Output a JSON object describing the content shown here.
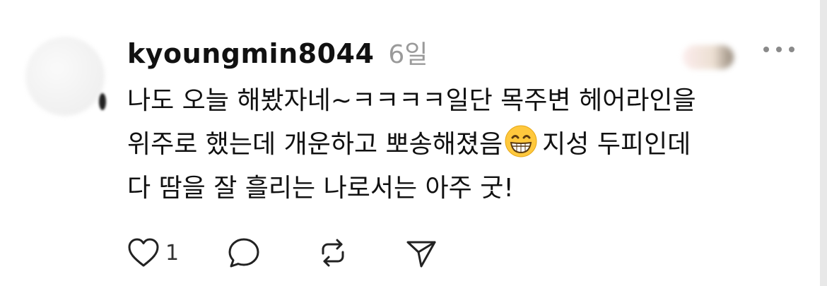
{
  "comment": {
    "username": "kyoungmin8044",
    "timestamp": "6일",
    "body_lines": [
      "나도 오늘 해봤자네~ㅋㅋㅋㅋ일단 목주변 헤어라인을",
      "위주로 했는데 개운하고 뽀송해졌음",
      "지성 두피인데",
      "다 땀을 잘 흘리는 나로서는 아주 굿!"
    ],
    "emoji": "grinning-face-with-smiling-eyes"
  },
  "actions": {
    "like_count": "1",
    "icons": {
      "like": "heart-icon",
      "reply": "comment-bubble-icon",
      "repost": "repost-icon",
      "share": "send-icon",
      "more": "more-dots-icon"
    }
  },
  "colors": {
    "text": "#111111",
    "muted": "#9a9a9a",
    "icon": "#222222",
    "background": "#ffffff"
  }
}
